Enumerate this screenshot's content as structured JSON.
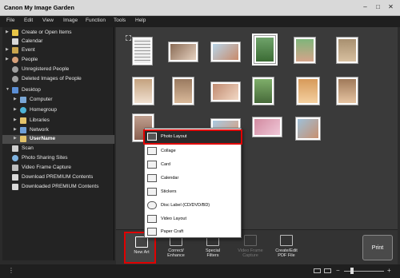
{
  "window": {
    "title": "Canon My Image Garden"
  },
  "menubar": [
    "File",
    "Edit",
    "View",
    "Image",
    "Function",
    "Tools",
    "Help"
  ],
  "sidebar": {
    "items": [
      {
        "label": "Create or Open Items",
        "icon": "star-icon"
      },
      {
        "label": "Calendar",
        "icon": "calendar-icon"
      },
      {
        "label": "Event",
        "icon": "event-icon"
      },
      {
        "label": "People",
        "icon": "people-icon"
      },
      {
        "label": "Unregistered People",
        "icon": "person-icon"
      },
      {
        "label": "Deleted Images of People",
        "icon": "person-icon"
      },
      {
        "label": "Desktop",
        "icon": "folder-icon"
      },
      {
        "label": "Computer",
        "icon": "computer-icon"
      },
      {
        "label": "Homegroup",
        "icon": "homegroup-icon"
      },
      {
        "label": "Libraries",
        "icon": "folder-icon"
      },
      {
        "label": "Network",
        "icon": "network-icon"
      },
      {
        "label": "UserName",
        "icon": "folder-icon"
      },
      {
        "label": "Scan",
        "icon": "scan-icon"
      },
      {
        "label": "Photo Sharing Sites",
        "icon": "globe-icon"
      },
      {
        "label": "Video Frame Capture",
        "icon": "film-icon"
      },
      {
        "label": "Download PREMIUM Contents",
        "icon": "download-icon"
      },
      {
        "label": "Downloaded PREMIUM Contents",
        "icon": "download-icon"
      }
    ]
  },
  "toolbar": {
    "new_art": "New Art",
    "correct_enhance_1": "Correct/",
    "correct_enhance_2": "Enhance",
    "special_filters_1": "Special",
    "special_filters_2": "Filters",
    "video_frame_capture_1": "Video Frame",
    "video_frame_capture_2": "Capture",
    "create_edit_pdf_1": "Create/Edit",
    "create_edit_pdf_2": "PDF File",
    "print": "Print"
  },
  "popup_menu": {
    "items": [
      "Photo Layout",
      "Collage",
      "Card",
      "Calendar",
      "Stickers",
      "Disc Label (CD/DVD/BD)",
      "Video Layout",
      "Paper Craft"
    ]
  },
  "colors": {
    "highlight": "#e00000",
    "background": "#2b2b2b"
  }
}
